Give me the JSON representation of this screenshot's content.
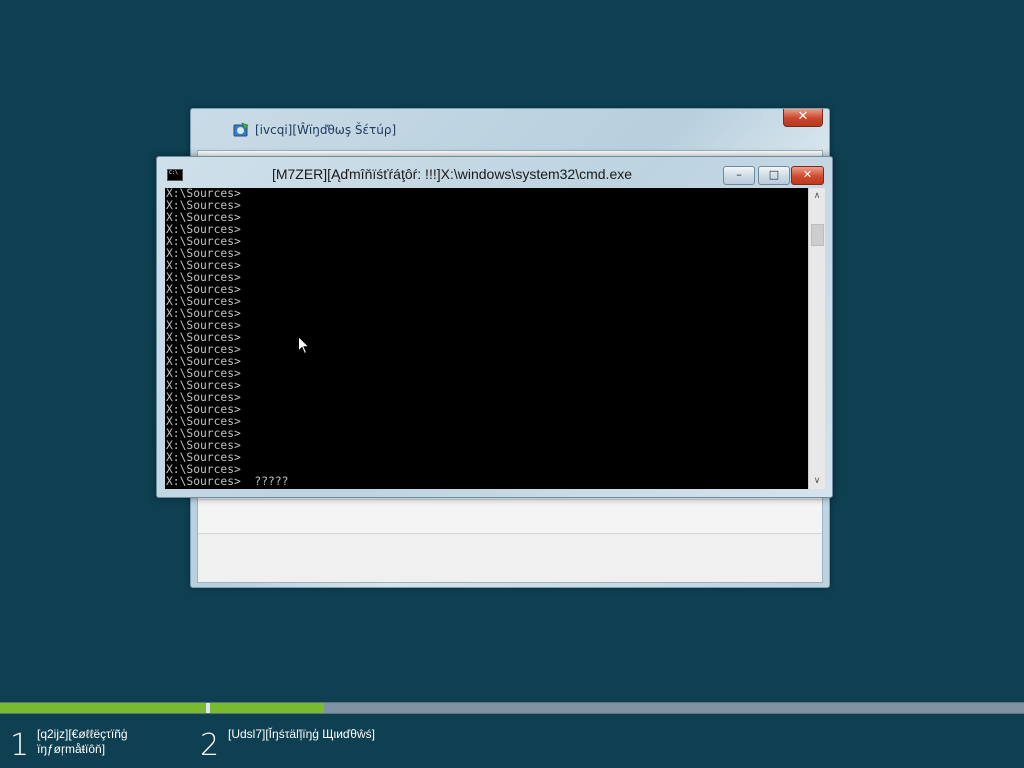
{
  "setup_window": {
    "title": "[ivcqi][Ŵïŋďθωş Šέτúρ]",
    "close_label": "✕",
    "icon": "setup-disc-icon"
  },
  "cmd_window": {
    "title": "[M7ZER][Ąďmîňïśťŕáţôŕ:  !!!]X:\\windows\\system32\\cmd.exe",
    "min_label": "–",
    "max_label": "□",
    "close_label": "✕",
    "icon": "console-icon",
    "prompt_line": "X:\\Sources>",
    "prompt_count": 24,
    "last_line": "X:\\Sources>  ?????",
    "scroll_up_label": "∧",
    "scroll_down_label": "∨"
  },
  "progress": {
    "step1_fraction": 1.0,
    "step2_fraction": 0.14,
    "colors": {
      "done": "#79bb2e",
      "track": "#7f93a2"
    }
  },
  "steps": [
    {
      "number": "1",
      "label_line1": "[q2ijz][€øℓℓëçτïñģ",
      "label_line2": "ïŋƒøŗmåŧïôň]"
    },
    {
      "number": "2",
      "label_line1": "[Udsl7][Ĭŋśτäľļïŋģ Щιиďθŵś]",
      "label_line2": ""
    }
  ]
}
